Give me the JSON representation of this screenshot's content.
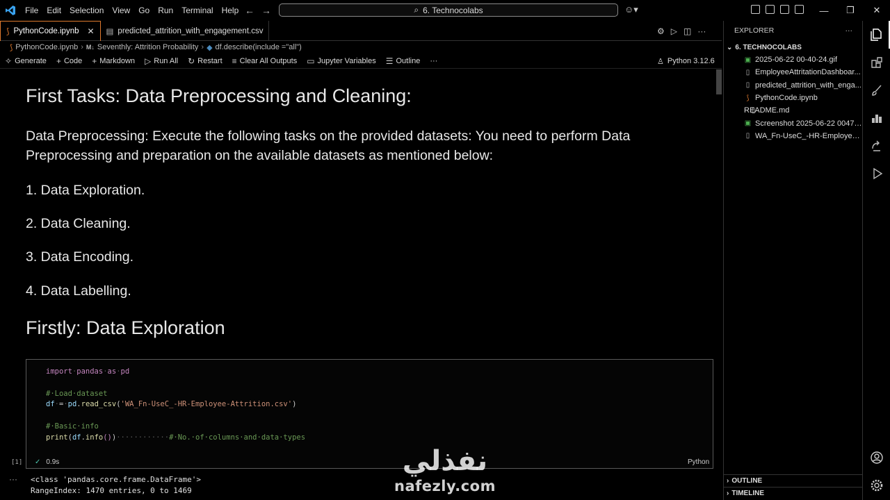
{
  "titlebar": {
    "menu": [
      "File",
      "Edit",
      "Selection",
      "View",
      "Go",
      "Run",
      "Terminal",
      "Help"
    ],
    "search_text": "6. Technocolabs"
  },
  "tabs": [
    {
      "label": "PythonCode.ipynb",
      "active": true
    },
    {
      "label": "predicted_attrition_with_engagement.csv",
      "active": false
    }
  ],
  "breadcrumb": {
    "file": "PythonCode.ipynb",
    "section": "Seventhly: Attrition Probability",
    "symbol": "df.describe(include =\"all\")"
  },
  "toolbar": {
    "generate": "Generate",
    "code": "Code",
    "markdown": "Markdown",
    "run_all": "Run All",
    "restart": "Restart",
    "clear_all_outputs": "Clear All Outputs",
    "jupyter_variables": "Jupyter Variables",
    "outline": "Outline",
    "kernel": "Python 3.12.6"
  },
  "notebook": {
    "heading1": "First Tasks: Data Preprocessing and Cleaning:",
    "para1": "Data Preprocessing: Execute the following tasks on the provided datasets: You need to perform Data Preprocessing and preparation on the available datasets as mentioned below:",
    "list": [
      "1. Data Exploration.",
      "2. Data Cleaning.",
      "3. Data Encoding.",
      "4. Data Labelling."
    ],
    "heading2": "Firstly: Data Exploration",
    "code": {
      "line1_kw": "import",
      "line1_rest": "pandas",
      "line1_as": "as",
      "line1_alias": "pd",
      "line3": "#·Load·dataset",
      "line4_var": "df",
      "line4_mod": "pd",
      "line4_fn": "read_csv",
      "line4_str": "'WA_Fn-UseC_-HR-Employee-Attrition.csv'",
      "line6": "#·Basic·info",
      "line7_fn": "print",
      "line7_var": "df",
      "line7_meth": "info",
      "line7_comment": "#·No.·of·columns·and·data·types"
    },
    "cell_index": "[1]",
    "cell_time": "0.9s",
    "cell_lang": "Python",
    "output": [
      "<class 'pandas.core.frame.DataFrame'>",
      "RangeIndex: 1470 entries, 0 to 1469"
    ]
  },
  "explorer": {
    "title": "EXPLORER",
    "folder": "6. TECHNOCOLABS",
    "files": [
      {
        "name": "2025-06-22 00-40-24.gif",
        "icon": "image-icon"
      },
      {
        "name": "EmployeeAttritationDashboar...",
        "icon": "file-icon"
      },
      {
        "name": "predicted_attrition_with_enga...",
        "icon": "file-icon"
      },
      {
        "name": "PythonCode.ipynb",
        "icon": "notebook-icon"
      },
      {
        "name": "README.md",
        "icon": "markdown-icon"
      },
      {
        "name": "Screenshot 2025-06-22 00475...",
        "icon": "image-icon"
      },
      {
        "name": "WA_Fn-UseC_-HR-Employee-...",
        "icon": "file-icon"
      }
    ],
    "outline": "OUTLINE",
    "timeline": "TIMELINE"
  },
  "watermark": {
    "arabic": "نفذلي",
    "latin": "nafezly.com"
  },
  "colors": {
    "accent_tab": "#e07a2e",
    "string": "#ce9178",
    "keyword": "#c586c0",
    "comment": "#6a9955"
  }
}
